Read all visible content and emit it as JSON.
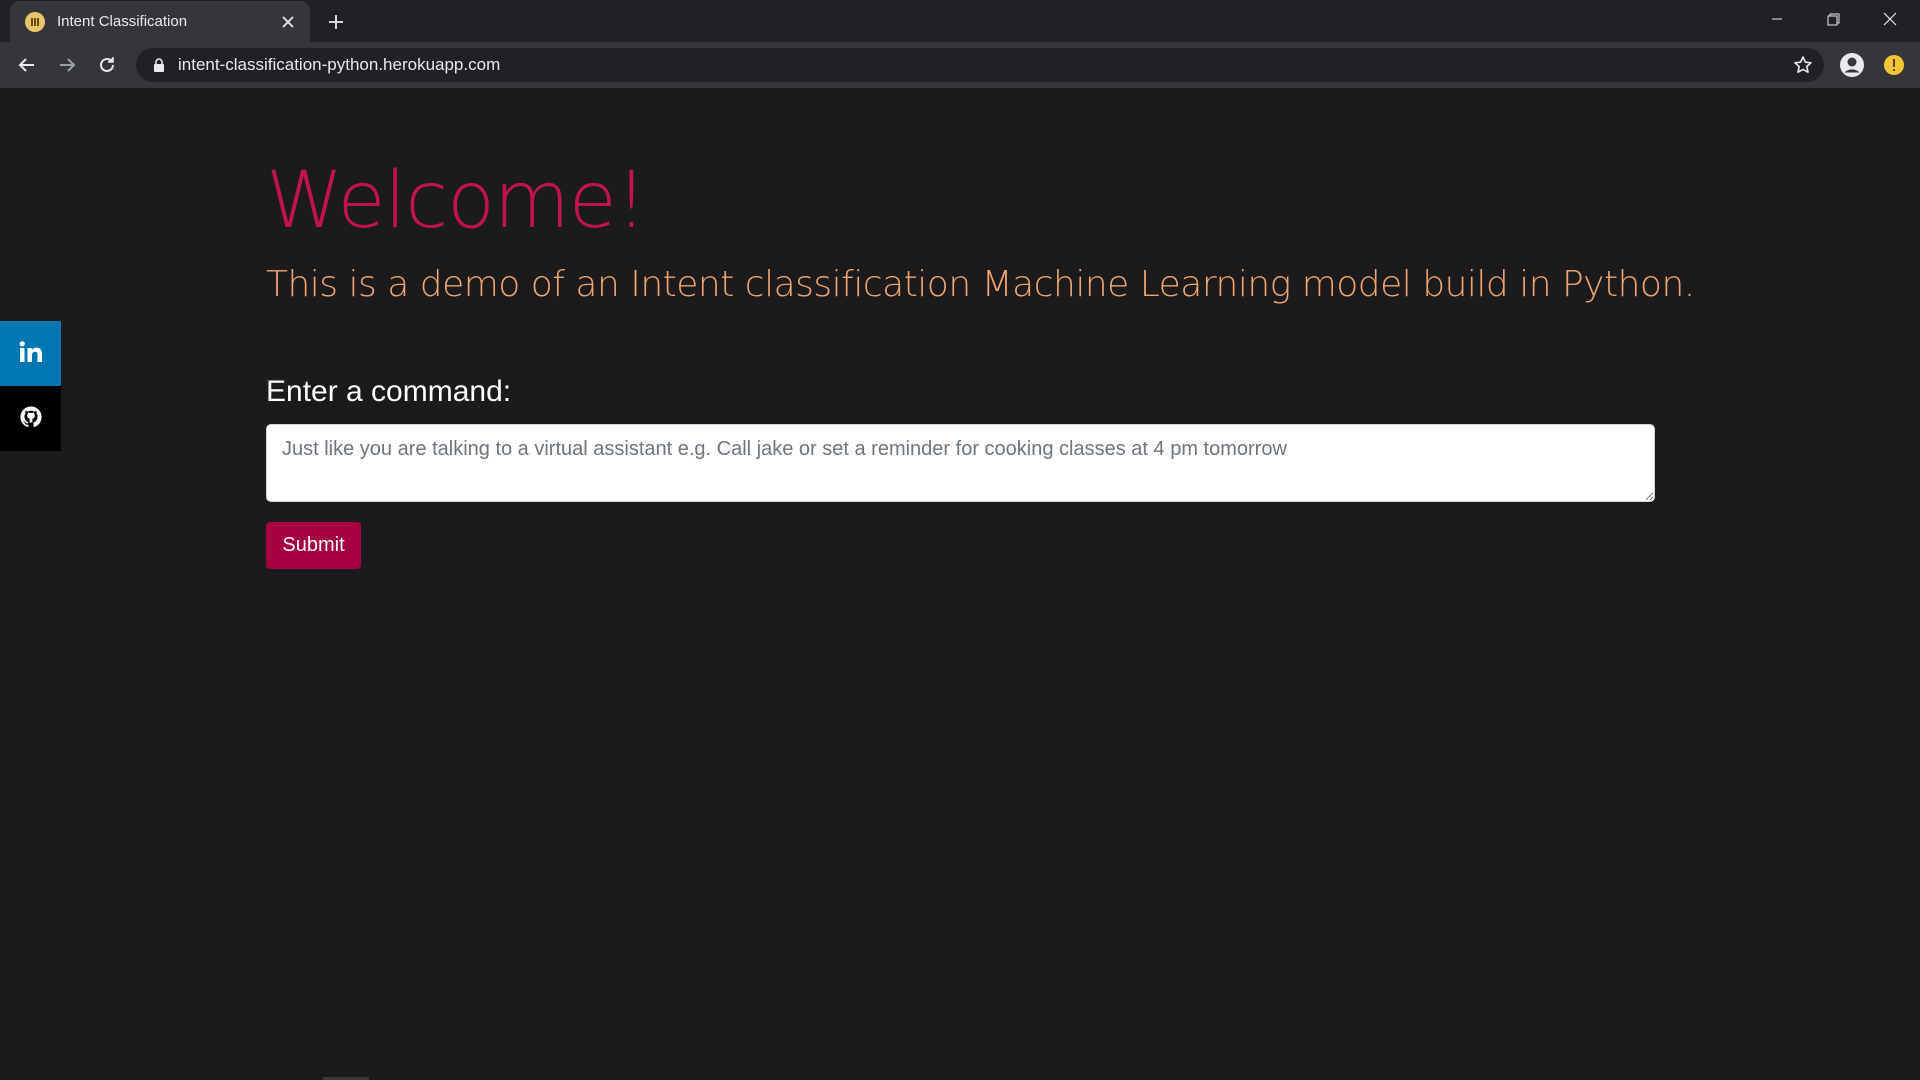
{
  "browser": {
    "tab": {
      "title": "Intent Classification",
      "favicon": "heroku-favicon-icon"
    },
    "url": "intent-classification-python.herokuapp.com",
    "colors": {
      "tabstrip": "#202124",
      "toolbar": "#35363a",
      "omnibox": "#202124",
      "text": "#e8eaed",
      "alert": "#f4c534"
    }
  },
  "sidebar": {
    "items": [
      {
        "name": "linkedin",
        "icon": "linkedin-icon",
        "color": "#0077b5"
      },
      {
        "name": "github",
        "icon": "github-icon",
        "color": "#000000"
      }
    ]
  },
  "main": {
    "heading": "Welcome!",
    "subtitle": "This is a demo of an Intent classification Machine Learning model build in Python.",
    "command_label": "Enter a command:",
    "command_input": {
      "value": "",
      "placeholder": "Just like you are talking to a virtual assistant e.g. Call jake or set a reminder for cooking classes at 4 pm tomorrow"
    },
    "submit_label": "Submit",
    "colors": {
      "background": "#1b1b1e",
      "heading": "#c3134f",
      "subtitle": "#f2a56c",
      "button": "#a5003f"
    }
  }
}
